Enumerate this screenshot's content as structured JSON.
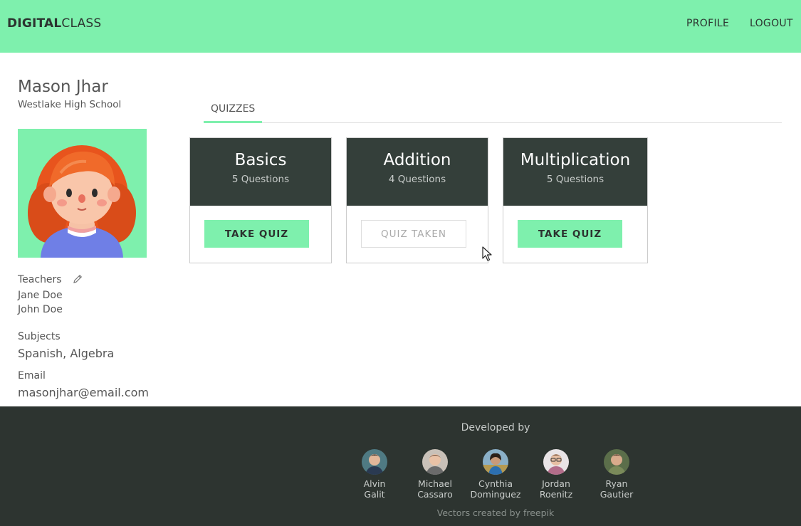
{
  "header": {
    "brand_bold": "DIGITAL",
    "brand_light": "CLASS",
    "nav": {
      "profile": "PROFILE",
      "logout": "LOGOUT"
    }
  },
  "profile": {
    "name": "Mason Jhar",
    "school": "Westlake High School",
    "teachers_label": "Teachers",
    "teachers": [
      "Jane Doe",
      "John Doe"
    ],
    "subjects_label": "Subjects",
    "subjects": "Spanish, Algebra",
    "email_label": "Email",
    "email": "masonjhar@email.com"
  },
  "tabs": [
    {
      "label": "QUIZZES",
      "active": true
    }
  ],
  "quizzes": [
    {
      "title": "Basics",
      "questions": "5 Questions",
      "button": "TAKE QUIZ",
      "taken": false
    },
    {
      "title": "Addition",
      "questions": "4 Questions",
      "button": "QUIZ TAKEN",
      "taken": true
    },
    {
      "title": "Multiplication",
      "questions": "5 Questions",
      "button": "TAKE QUIZ",
      "taken": false
    }
  ],
  "footer": {
    "developed_by": "Developed by",
    "developers": [
      {
        "first": "Alvin",
        "last": "Galit"
      },
      {
        "first": "Michael",
        "last": "Cassaro"
      },
      {
        "first": "Cynthia",
        "last": "Dominguez"
      },
      {
        "first": "Jordan",
        "last": "Roenitz"
      },
      {
        "first": "Ryan",
        "last": "Gautier"
      }
    ],
    "credit": "Vectors created by freepik"
  },
  "colors": {
    "accent": "#7ef0ad",
    "dark": "#343f3a",
    "footer": "#2d3430",
    "text": "#555555"
  },
  "icons": [
    "pencil-icon",
    "mouse-cursor-icon"
  ]
}
